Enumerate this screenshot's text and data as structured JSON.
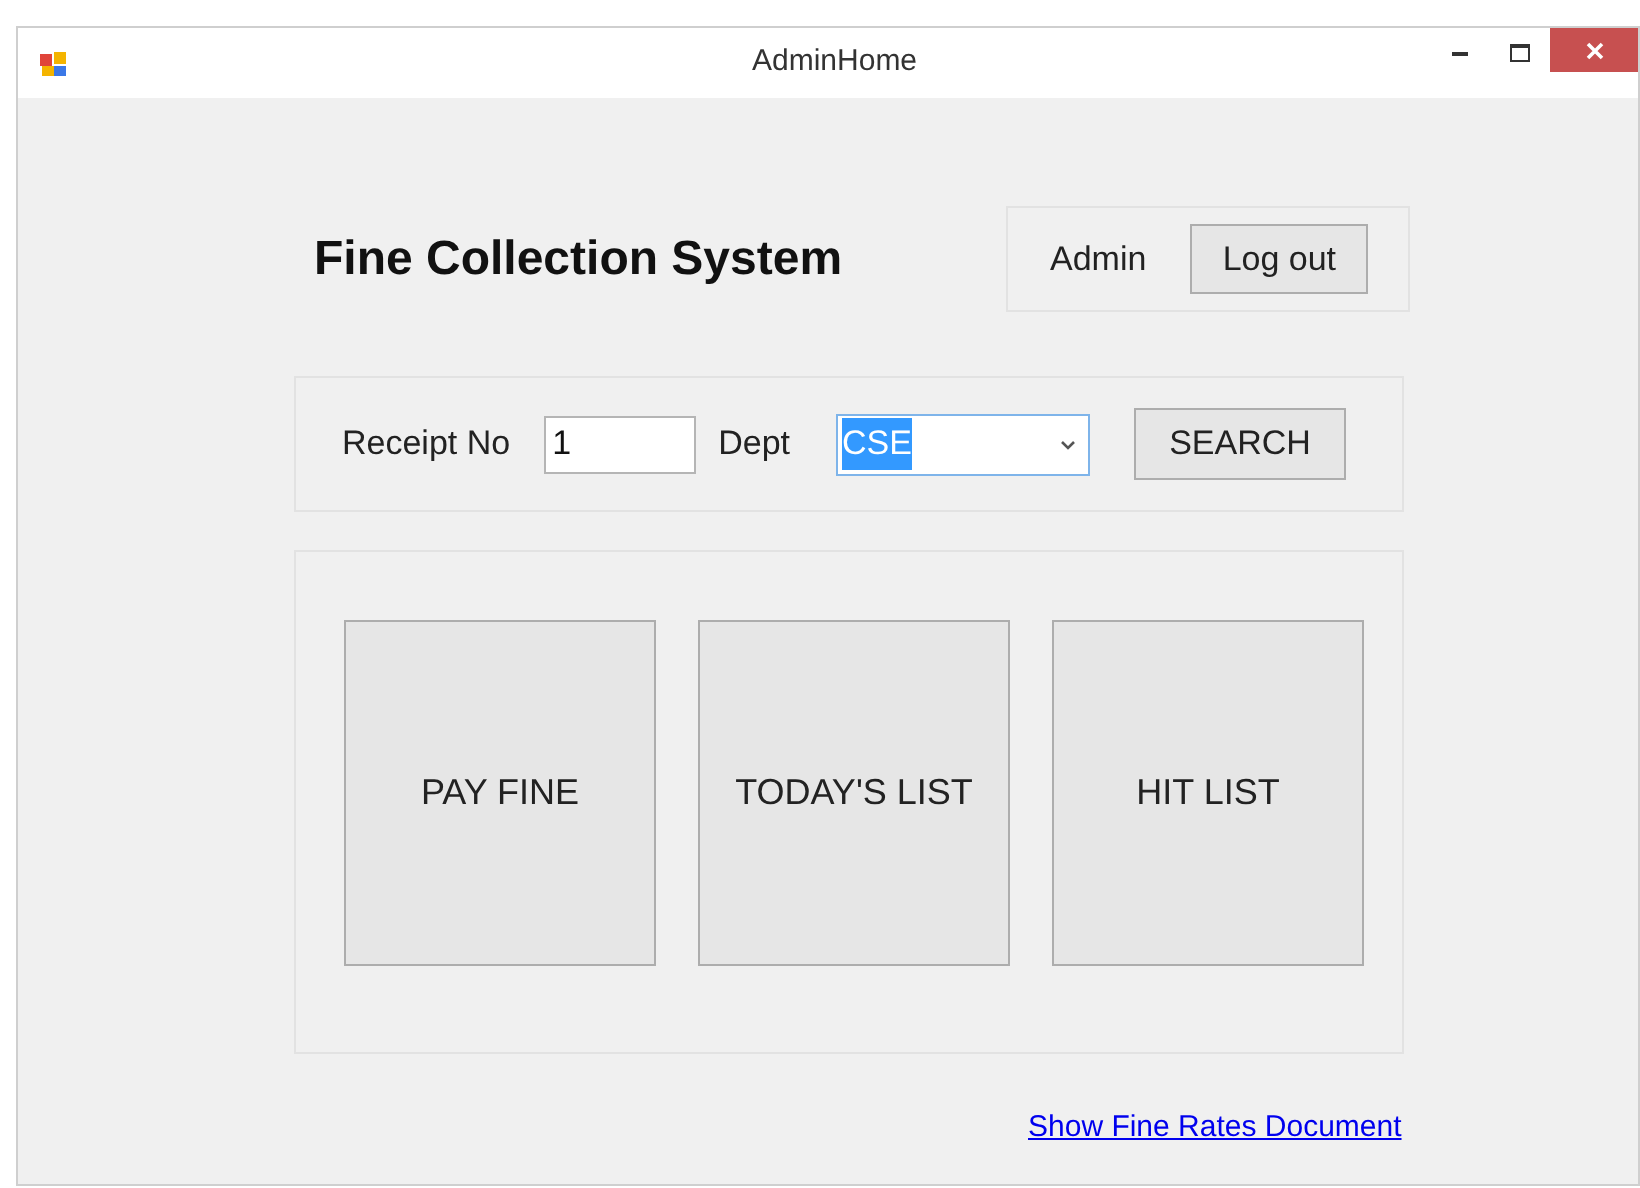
{
  "window": {
    "title": "AdminHome"
  },
  "header": {
    "title": "Fine Collection System",
    "user": "Admin",
    "logout": "Log out"
  },
  "search": {
    "receipt_label": "Receipt No",
    "receipt_value": "1",
    "dept_label": "Dept",
    "dept_value": "CSE",
    "dept_text_selected": true,
    "button": "SEARCH"
  },
  "actions": [
    "PAY FINE",
    "TODAY'S LIST",
    "HIT LIST"
  ],
  "link": "Show Fine Rates Document"
}
